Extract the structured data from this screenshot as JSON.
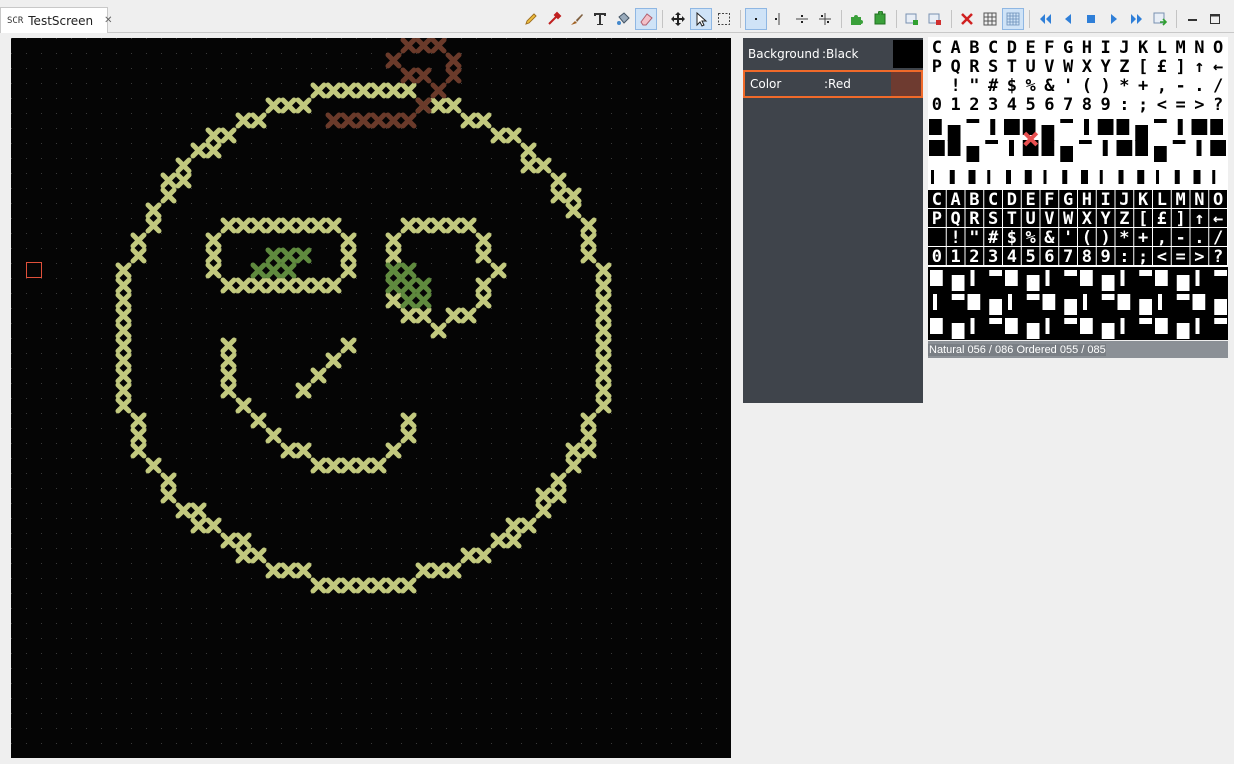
{
  "tab": {
    "type_icon": "SCR",
    "title": "TestScreen"
  },
  "toolbar": {
    "groups": [
      [
        "pencil-icon",
        "pipette-icon",
        "brush-icon",
        "text-icon",
        "fill-icon",
        "eraser-icon"
      ],
      [
        "move-icon",
        "select-icon",
        "marquee-icon"
      ],
      [
        "point-icon",
        "mirror-v-icon",
        "mirror-h-icon",
        "mirror-both-icon"
      ],
      [
        "puzzle-icon",
        "puzzle-alt-icon"
      ],
      [
        "add-screen-icon",
        "remove-screen-icon"
      ],
      [
        "clear-icon",
        "grid-icon",
        "grid-fine-icon"
      ],
      [
        "first-icon",
        "prev-icon",
        "stop-icon",
        "play-icon",
        "last-icon",
        "export-icon"
      ]
    ],
    "active": [
      "eraser-icon",
      "select-icon",
      "point-icon",
      "grid-fine-icon"
    ],
    "window_buttons": [
      "minimize-icon",
      "maximize-icon"
    ]
  },
  "color_panel": {
    "background": {
      "label": "Background",
      "value": ":Black",
      "color": "#000000"
    },
    "color": {
      "label": "Color",
      "value": ":Red",
      "color": "#6e3b30"
    }
  },
  "charset": {
    "status": "Natural 056 / 086 Ordered 055 / 085"
  },
  "colors": {
    "canvas_bg": "#050505",
    "stitch_yellow": "#c2c97e",
    "stitch_green": "#5f8a3e",
    "stitch_brown": "#6a3a2a",
    "accent_orange": "#f06a2a"
  }
}
